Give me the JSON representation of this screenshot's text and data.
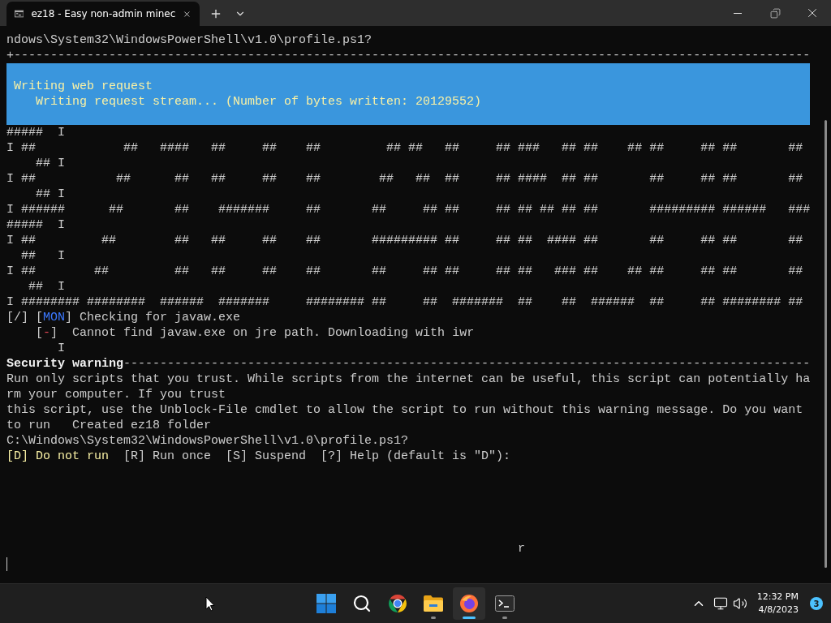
{
  "window": {
    "tabs": [
      {
        "title": "ez18 - Easy non-admin minec",
        "selected": true
      }
    ]
  },
  "terminal": {
    "header_lines": [
      {
        "segments": [
          {
            "text": "ndows\\System32\\WindowsPowerShell\\v1.0\\profile.ps1?"
          }
        ]
      },
      {
        "segments": [
          {
            "text": "+-------------------------------------------------------------------------------------------------------------"
          }
        ]
      }
    ],
    "progress": {
      "activity": "Writing web request",
      "status": "Writing request stream... (Number of bytes written: 20129552)"
    },
    "lines": [
      {
        "segments": [
          {
            "text": "#####  I"
          }
        ]
      },
      {
        "segments": [
          {
            "text": "I ##            ##   ####   ##     ##    ##         ## ##   ##     ## ###   ## ##    ## ##     ## ##       ##"
          }
        ]
      },
      {
        "segments": [
          {
            "text": "    ## I"
          }
        ]
      },
      {
        "segments": [
          {
            "text": "I ##           ##      ##   ##     ##    ##        ##   ##  ##     ## ####  ## ##       ##     ## ##       ##"
          }
        ]
      },
      {
        "segments": [
          {
            "text": "    ## I"
          }
        ]
      },
      {
        "segments": [
          {
            "text": "I ######      ##       ##    #######     ##       ##     ## ##     ## ## ## ## ##       ######### ######   ###"
          }
        ]
      },
      {
        "segments": [
          {
            "text": "#####  I"
          }
        ]
      },
      {
        "segments": [
          {
            "text": "I ##         ##        ##   ##     ##    ##       ######### ##     ## ##  #### ##       ##     ## ##       ##"
          }
        ]
      },
      {
        "segments": [
          {
            "text": "  ##   I"
          }
        ]
      },
      {
        "segments": [
          {
            "text": "I ##        ##         ##   ##     ##    ##       ##     ## ##     ## ##   ### ##    ## ##     ## ##       ##"
          }
        ]
      },
      {
        "segments": [
          {
            "text": "   ##  I"
          }
        ]
      },
      {
        "segments": [
          {
            "text": "I ######## ########  ######  #######     ######## ##     ##  #######  ##    ##  ######  ##     ## ######## ##"
          }
        ]
      },
      {
        "segments": [
          {
            "text": "[/] ["
          },
          {
            "text": "MON",
            "color": "#3b78ff"
          },
          {
            "text": "] Checking for javaw.exe"
          }
        ]
      },
      {
        "segments": [
          {
            "text": "    ["
          },
          {
            "text": "-",
            "color": "#e74856"
          },
          {
            "text": "]  Cannot find javaw.exe on jre path. Downloading with iwr"
          }
        ]
      },
      {
        "segments": [
          {
            "text": "       I"
          }
        ]
      },
      {
        "segments": [
          {
            "text": "Security warning",
            "color": "#f2f2f2",
            "bold": true
          },
          {
            "text": "----------------------------------------------------------------------------------------------"
          }
        ]
      },
      {
        "segments": [
          {
            "text": "Run only scripts that you trust. While scripts from the internet can be useful, this script can potentially ha"
          }
        ]
      },
      {
        "segments": [
          {
            "text": "rm your computer. If you trust"
          }
        ]
      },
      {
        "segments": [
          {
            "text": "this script, use the Unblock-File cmdlet to allow the script to run without this warning message. Do you want"
          }
        ]
      },
      {
        "segments": [
          {
            "text": "to run   Created ez18 folder"
          }
        ]
      },
      {
        "segments": [
          {
            "text": "C:\\Windows\\System32\\WindowsPowerShell\\v1.0\\profile.ps1?"
          }
        ]
      },
      {
        "segments": [
          {
            "text": "[D] Do not run",
            "color": "#f9f1a5"
          },
          {
            "text": "  [R] Run once  [S] Suspend  [?] Help (default is \"D\"):"
          }
        ]
      }
    ],
    "trailing_line": {
      "segments": [
        {
          "text": "                                                                      r"
        }
      ]
    }
  },
  "taskbar": {
    "apps": [
      {
        "kind": "start",
        "running": false,
        "selected": false
      },
      {
        "kind": "search",
        "running": false,
        "selected": false
      },
      {
        "kind": "chrome",
        "running": false,
        "selected": false
      },
      {
        "kind": "explorer",
        "running": true,
        "selected": false
      },
      {
        "kind": "firefox",
        "running": true,
        "selected": true
      },
      {
        "kind": "terminal",
        "running": true,
        "selected": false
      }
    ],
    "clock": {
      "time": "12:32 PM",
      "date": "4/8/2023"
    },
    "notifications": {
      "count": "3"
    }
  }
}
